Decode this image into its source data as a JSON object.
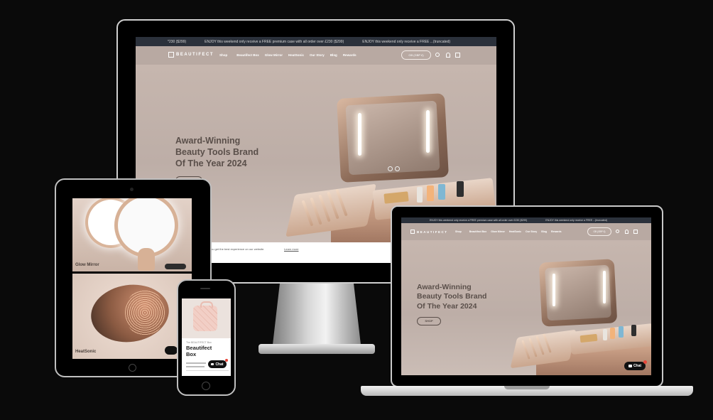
{
  "site": {
    "logo_text": "BEAUTIFECT",
    "announcements": [
      "*230 ($299)",
      "ENJOY this weekend only receive a FREE premium case with all order over £230 ($299)",
      "ENJOY this weekend only receive a FREE ...(truncated)"
    ],
    "laptop_announcement": "ENJOY this weekend only receive a FREE premium case with all order over £230 ($299)",
    "nav": [
      "Shop",
      "Beautifect Box",
      "Glow Mirror",
      "HeatSonic",
      "Our Story",
      "Blog",
      "Rewards"
    ],
    "currency": "GB (GBP £)",
    "hero": {
      "line1": "Award-Winning",
      "line2": "Beauty Tools Brand",
      "line3": "Of The Year 2024",
      "button": "SHOP"
    },
    "cookie_text": "you get the best experience on our website.",
    "cookie_link": "Learn more"
  },
  "tablet": {
    "card1": "Glow Mirror",
    "card2": "HeatSonic"
  },
  "phone": {
    "small_label": "The BEAUTIFECT Box",
    "title_line1": "Beautifect",
    "title_line2": "Box",
    "chat": "Chat"
  },
  "laptop": {
    "chat": "Chat"
  },
  "icons": [
    "search-icon",
    "account-icon",
    "cart-icon",
    "chat-icon",
    "chevron-down-icon",
    "arrow-right-icon"
  ]
}
